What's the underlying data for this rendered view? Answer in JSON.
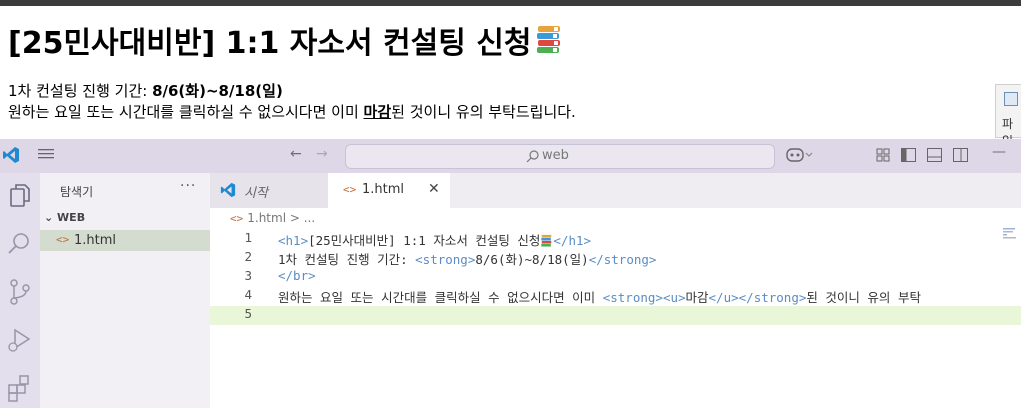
{
  "page": {
    "title": "[25민사대비반] 1:1 자소서 컨설팅 신청",
    "period_label": "1차 컨설팅 진행 기간: ",
    "period_value": "8/6(화)~8/18(일)",
    "notice_before": "원하는 요일 또는 시간대를 클릭하실 수 없으시다면 이미 ",
    "notice_bold": "마감",
    "notice_after": "된 것이니 유의 부탁드립니다."
  },
  "side_widget": {
    "label": "파일"
  },
  "vscode": {
    "search_text": "web",
    "sidebar_title": "탐색기",
    "sidebar_more": "···",
    "folder_name": "WEB",
    "files": [
      {
        "name": "1.html"
      }
    ],
    "tabs": [
      {
        "label": "시작"
      },
      {
        "label": "1.html"
      }
    ],
    "breadcrumb": "1.html > ...",
    "code_lines": [
      {
        "num": "1",
        "parts": [
          [
            "tagb",
            "<h1>"
          ],
          [
            "txt",
            "[25민사대비반] 1:1 자소서 컨설팅 신청"
          ],
          [
            "emoji",
            ""
          ],
          [
            "tagb",
            "</h1>"
          ]
        ]
      },
      {
        "num": "2",
        "parts": [
          [
            "txt",
            "1차 컨설팅 진행 기간: "
          ],
          [
            "tagb",
            "<strong>"
          ],
          [
            "txt",
            "8/6(화)~8/18(일)"
          ],
          [
            "tagb",
            "</strong>"
          ]
        ]
      },
      {
        "num": "3",
        "parts": [
          [
            "tagb",
            "</br>"
          ]
        ]
      },
      {
        "num": "4",
        "parts": [
          [
            "txt",
            "원하는 요일 또는 시간대를 클릭하실 수 없으시다면 이미 "
          ],
          [
            "tagb",
            "<strong>"
          ],
          [
            "tagb",
            "<u>"
          ],
          [
            "txt",
            "마감"
          ],
          [
            "tagb",
            "</u>"
          ],
          [
            "tagb",
            "</strong>"
          ],
          [
            "txt",
            "된 것이니 유의 부탁"
          ]
        ]
      },
      {
        "num": "5",
        "parts": []
      }
    ],
    "active_line": 5
  },
  "colors": {
    "titlebar": "#ddd7e7",
    "activitybar": "#e4dfec",
    "sidebar": "#f2f0f5",
    "active_line": "#e9f6d7",
    "html_tag": "#5b8cc4",
    "file_icon": "#c2703d"
  },
  "icons": {
    "vscode_logo": "vscode-logo-icon",
    "menu": "hamburger-menu-icon",
    "back": "arrow-left-icon",
    "forward": "arrow-right-icon",
    "search": "search-icon",
    "copilot": "copilot-icon",
    "explorer": "files-icon",
    "scm": "source-control-icon",
    "debug": "run-debug-icon",
    "extensions": "extensions-icon",
    "books": "books-emoji-icon"
  }
}
